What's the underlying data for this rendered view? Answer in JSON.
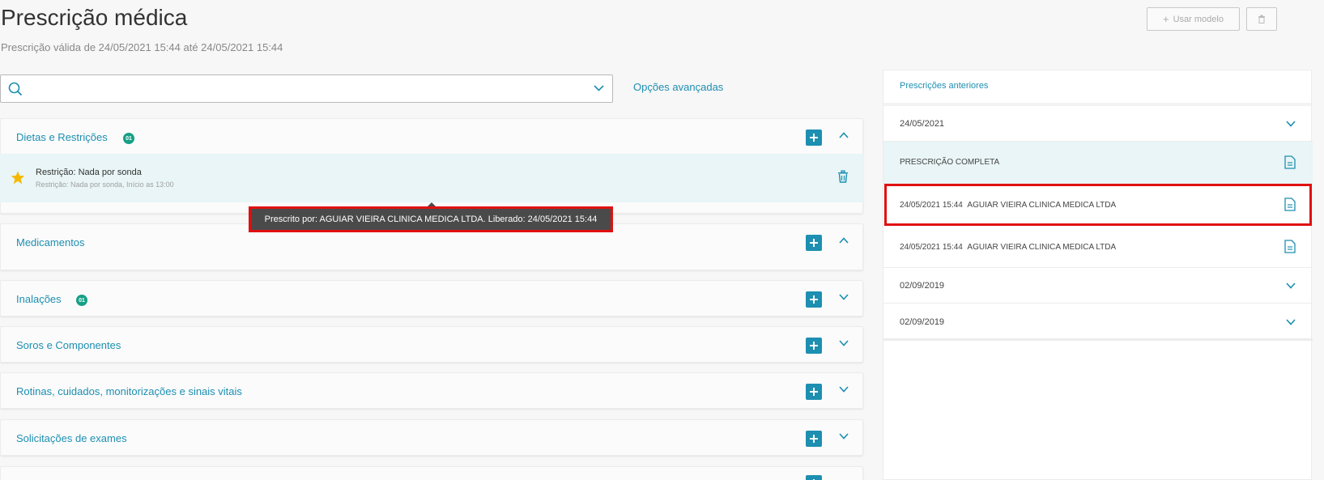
{
  "header": {
    "title": "Prescrição médica",
    "validity": "Prescrição válida de 24/05/2021 15:44 até 24/05/2021 15:44",
    "use_model_label": "Usar modelo"
  },
  "search": {
    "value": "",
    "placeholder": "",
    "advanced_options_label": "Opções avançadas"
  },
  "sections": [
    {
      "title": "Dietas e Restrições",
      "badge": "01",
      "expanded": true
    },
    {
      "title": "Medicamentos",
      "badge": "",
      "expanded": true
    },
    {
      "title": "Inalações",
      "badge": "01",
      "expanded": false
    },
    {
      "title": "Soros e Componentes",
      "badge": "",
      "expanded": false
    },
    {
      "title": "Rotinas, cuidados, monitorizações e sinais vitais",
      "badge": "",
      "expanded": false
    },
    {
      "title": "Solicitações de exames",
      "badge": "",
      "expanded": false
    }
  ],
  "diet_item": {
    "title": "Restrição: Nada por sonda",
    "subtitle": "Restrição: Nada por sonda, Início as 13:00"
  },
  "tooltip": {
    "text": "Prescrito por: AGUIAR VIEIRA CLINICA MEDICA LTDA. Liberado: 24/05/2021 15:44"
  },
  "previous": {
    "title": "Prescrições anteriores",
    "groups": [
      {
        "date": "24/05/2021"
      },
      {
        "date": "02/09/2019"
      },
      {
        "date": "02/09/2019"
      }
    ],
    "complete_label": "PRESCRIÇÃO COMPLETA",
    "entries": [
      {
        "datetime": "24/05/2021 15:44",
        "doctor": "AGUIAR VIEIRA CLINICA MEDICA LTDA"
      },
      {
        "datetime": "24/05/2021 15:44",
        "doctor": "AGUIAR VIEIRA CLINICA MEDICA LTDA"
      }
    ]
  },
  "colors": {
    "accent": "#1d8fb1",
    "badge": "#16a085",
    "highlight": "#e01010",
    "star": "#f5b800"
  }
}
